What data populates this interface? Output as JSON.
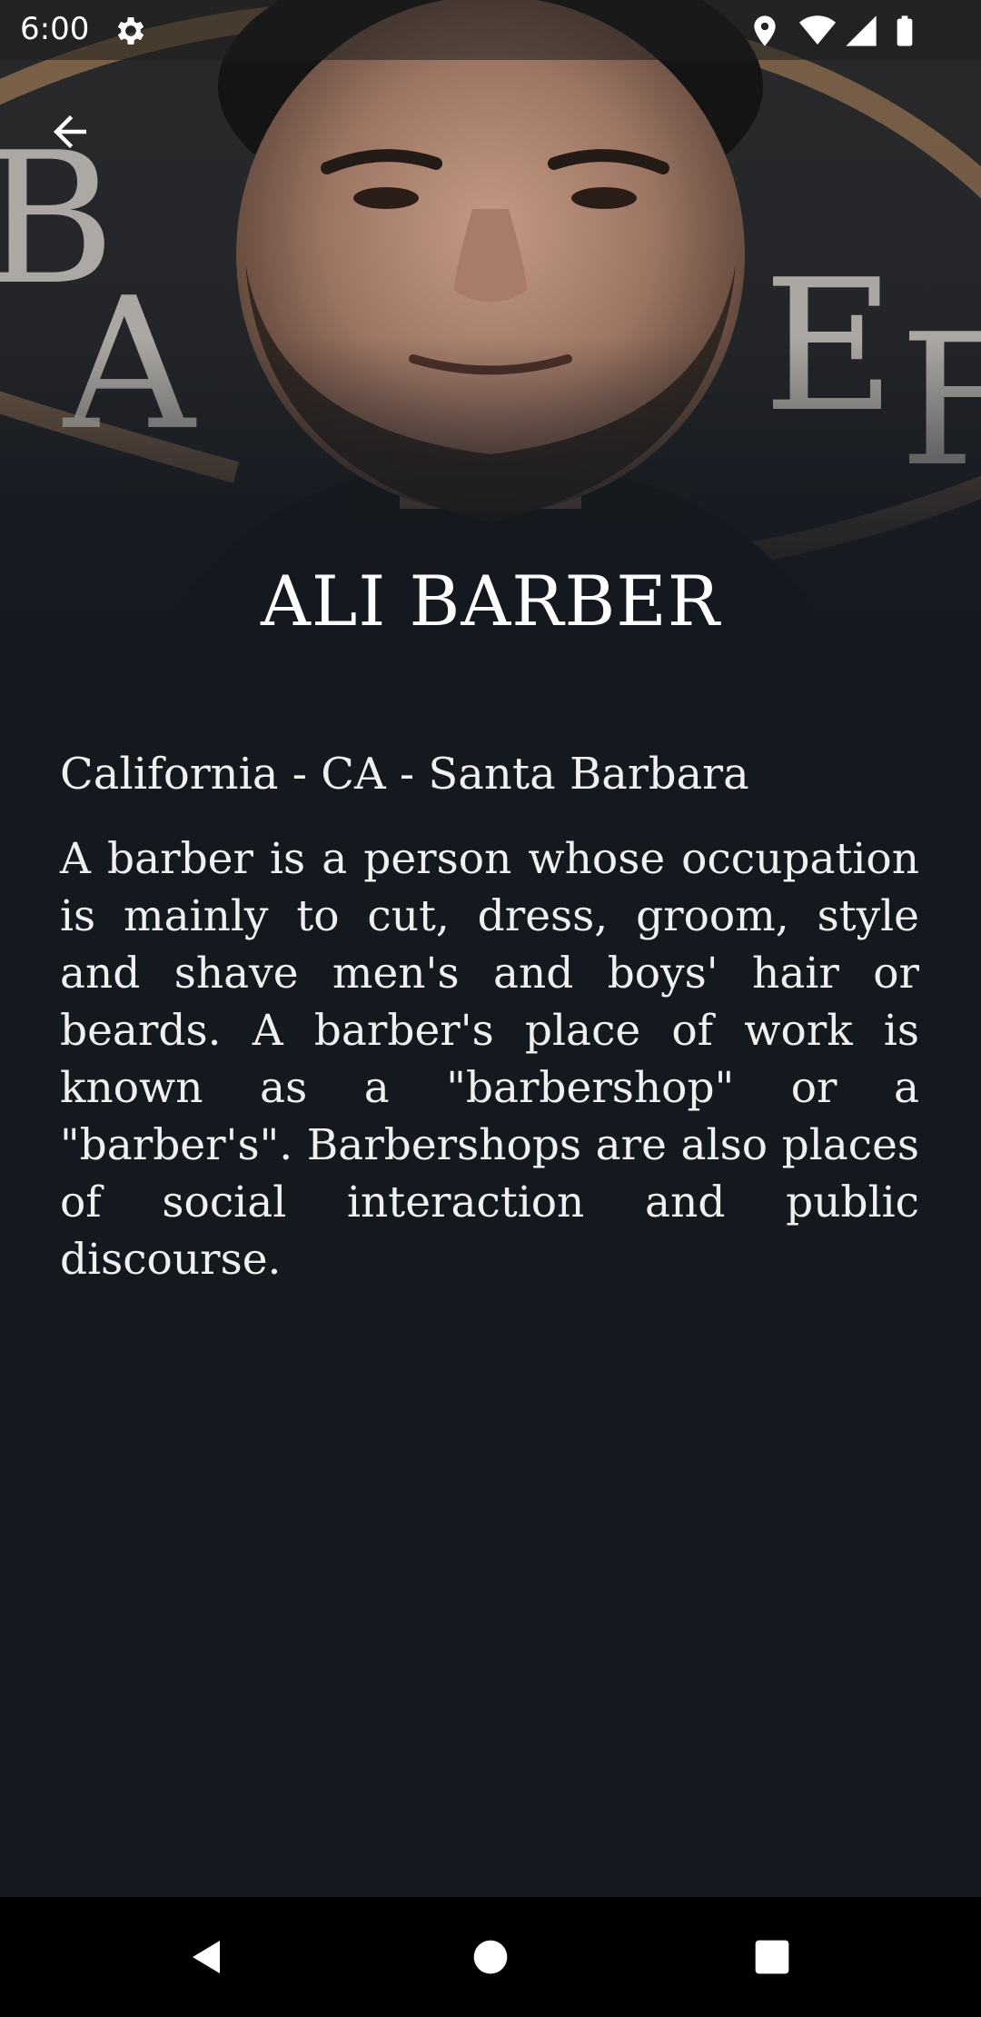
{
  "status_bar": {
    "time": "6:00",
    "icons": [
      "gear-icon",
      "location-icon",
      "wifi-icon",
      "signal-icon",
      "battery-icon"
    ]
  },
  "header": {
    "back_icon": "arrow-left-icon",
    "title": "ALI BARBER"
  },
  "profile": {
    "location": "California - CA - Santa Barbara",
    "description": "A barber is a person whose occupation is mainly to cut, dress, groom, style and shave men's and boys' hair or beards. A barber's place of work is known as a \"barbershop\" or a \"barber's\". Barbershops are also places of social interaction and public discourse."
  },
  "nav_bar": {
    "icons": [
      "back-triangle-icon",
      "home-circle-icon",
      "recents-square-icon"
    ]
  },
  "colors": {
    "background": "#141920",
    "text": "#f0f0f0",
    "nav_bar": "#000000",
    "signage_gold": "#8a6a4e"
  }
}
